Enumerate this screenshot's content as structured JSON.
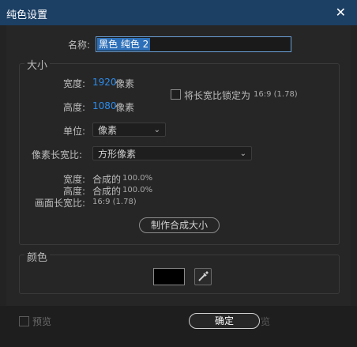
{
  "window": {
    "title": "纯色设置",
    "close_glyph": "✕"
  },
  "name_field": {
    "label": "名称:",
    "value": "黑色 纯色 2"
  },
  "size_group": {
    "title": "大小",
    "width_label": "宽度:",
    "width_value": "1920",
    "width_unit": "像素",
    "height_label": "高度:",
    "height_value": "1080",
    "height_unit": "像素",
    "lock_label": "将长宽比锁定为",
    "lock_ratio": "16:9 (1.78)",
    "unit_label": "单位:",
    "unit_value": "像素",
    "aspect_label": "像素长宽比:",
    "aspect_value": "方形像素",
    "info_width_label": "宽度:",
    "info_width_text": "合成的",
    "info_width_pct": "100.0%",
    "info_height_label": "高度:",
    "info_height_text": "合成的",
    "info_height_pct": "100.0%",
    "info_frame_label": "画面长宽比:",
    "info_frame_value": "16:9 (1.78)",
    "make_comp_size_button": "制作合成大小"
  },
  "color_group": {
    "title": "颜色",
    "swatch_color": "#000000"
  },
  "footer": {
    "preview_label": "预览",
    "ok_button": "确定",
    "ghost_text": "览"
  }
}
